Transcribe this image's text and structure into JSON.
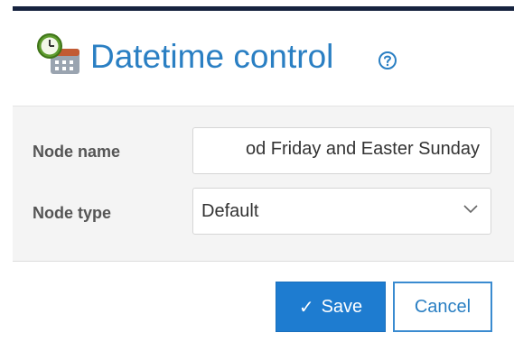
{
  "dialog": {
    "title": "Datetime control",
    "help_icon": "question-circle-icon",
    "header_icon": "calendar-clock-icon"
  },
  "form": {
    "node_name_label": "Node name",
    "node_name_value": "od Friday and Easter Sunday",
    "node_type_label": "Node type",
    "node_type_value": "Default"
  },
  "footer": {
    "save_label": "Save",
    "cancel_label": "Cancel"
  },
  "colors": {
    "title": "#2a7fc3",
    "primary_button": "#1e7cd0",
    "top_border": "#16233f"
  }
}
